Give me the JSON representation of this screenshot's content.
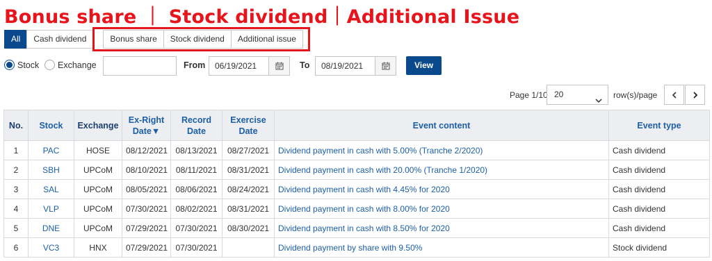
{
  "headline": "Bonus share ｜ Stock dividend｜Additional Issue",
  "tabs": [
    {
      "label": "All",
      "active": true
    },
    {
      "label": "Cash dividend",
      "active": false
    },
    {
      "label": "Bonus share",
      "active": false
    },
    {
      "label": "Stock dividend",
      "active": false
    },
    {
      "label": "Additional issue",
      "active": false
    }
  ],
  "filters": {
    "radio_stock": "Stock",
    "radio_exchange": "Exchange",
    "selected": "Stock",
    "search_value": "",
    "from_label": "From",
    "from_date": "06/19/2021",
    "to_label": "To",
    "to_date": "08/19/2021",
    "view_label": "View"
  },
  "pager": {
    "page_text": "Page  1/10",
    "rows_per_page": "20",
    "rpp_label": "row(s)/page",
    "prev": "‹",
    "next": "›"
  },
  "table": {
    "headers": {
      "no": "No.",
      "stock": "Stock",
      "exchange": "Exchange",
      "ex_right_date": "Ex-Right Date▼",
      "record_date": "Record Date",
      "exercise_date": "Exercise Date",
      "event_content": "Event content",
      "event_type": "Event type"
    },
    "rows": [
      {
        "no": "1",
        "stock": "PAC",
        "exchange": "HOSE",
        "ex_right": "08/12/2021",
        "record": "08/13/2021",
        "exercise": "08/27/2021",
        "content": "Dividend payment in cash with 5.00% (Tranche 2/2020)",
        "type": "Cash dividend"
      },
      {
        "no": "2",
        "stock": "SBH",
        "exchange": "UPCoM",
        "ex_right": "08/10/2021",
        "record": "08/11/2021",
        "exercise": "08/31/2021",
        "content": "Dividend payment in cash with 20.00% (Tranche 1/2020)",
        "type": "Cash dividend"
      },
      {
        "no": "3",
        "stock": "SAL",
        "exchange": "UPCoM",
        "ex_right": "08/05/2021",
        "record": "08/06/2021",
        "exercise": "08/24/2021",
        "content": "Dividend payment in cash with 4.45% for 2020",
        "type": "Cash dividend"
      },
      {
        "no": "4",
        "stock": "VLP",
        "exchange": "UPCoM",
        "ex_right": "07/30/2021",
        "record": "08/02/2021",
        "exercise": "08/31/2021",
        "content": "Dividend payment in cash with 8.00% for 2020",
        "type": "Cash dividend"
      },
      {
        "no": "5",
        "stock": "DNE",
        "exchange": "UPCoM",
        "ex_right": "07/29/2021",
        "record": "07/30/2021",
        "exercise": "08/30/2021",
        "content": "Dividend payment in cash with 8.50% for 2020",
        "type": "Cash dividend"
      },
      {
        "no": "6",
        "stock": "VC3",
        "exchange": "HNX",
        "ex_right": "07/29/2021",
        "record": "07/30/2021",
        "exercise": "",
        "content": "Dividend payment by share with 9.50%",
        "type": "Stock dividend"
      }
    ]
  },
  "colors": {
    "headline": "#e8141c",
    "accent": "#0a4a8c",
    "link": "#1c5fa6",
    "highlight_box": "#e3161d"
  }
}
